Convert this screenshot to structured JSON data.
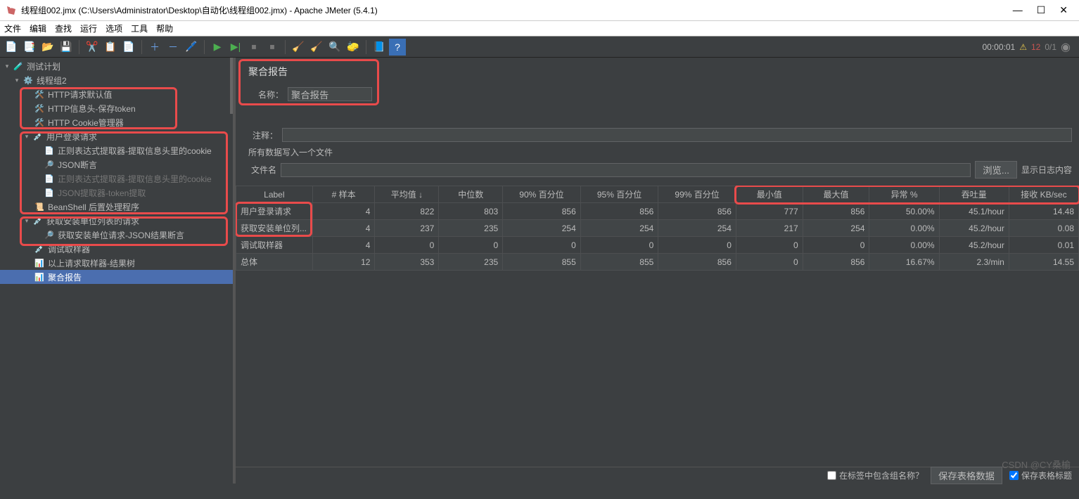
{
  "window": {
    "title": "线程组002.jmx (C:\\Users\\Administrator\\Desktop\\自动化\\线程组002.jmx) - Apache JMeter (5.4.1)"
  },
  "menu": {
    "file": "文件",
    "edit": "编辑",
    "find": "查找",
    "run": "运行",
    "options": "选项",
    "tools": "工具",
    "help": "帮助"
  },
  "status": {
    "timer": "00:00:01",
    "errors": "12",
    "threads": "0/1"
  },
  "tree": {
    "root": "测试计划",
    "threadGroup": "线程组2",
    "httpDefault": "HTTP请求默认值",
    "httpHeader": "HTTP信息头-保存token",
    "httpCookie": "HTTP Cookie管理器",
    "login": "用户登录请求",
    "regex1": "正则表达式提取器-提取信息头里的cookie",
    "jsonAssert": "JSON断言",
    "regex2": "正则表达式提取器-提取信息头里的cookie",
    "jsonExtract": "JSON提取器-token提取",
    "beanshell": "BeanShell 后置处理程序",
    "getList": "获取安装单位列表的请求",
    "getListAssert": "获取安装单位请求-JSON结果断言",
    "debugSampler": "调试取样器",
    "resultTree": "以上请求取样器-结果树",
    "aggregate": "聚合报告"
  },
  "form": {
    "sectionTitle": "聚合报告",
    "nameLabel": "名称：",
    "nameValue": "聚合报告",
    "commentLabel": "注释：",
    "writeAllLabel": "所有数据写入一个文件",
    "fileLabel": "文件名",
    "browse": "浏览...",
    "showLog": "显示日志内容"
  },
  "table": {
    "headers": {
      "label": "Label",
      "samples": "# 样本",
      "avg": "平均值 ↓",
      "median": "中位数",
      "p90": "90% 百分位",
      "p95": "95% 百分位",
      "p99": "99% 百分位",
      "min": "最小值",
      "max": "最大值",
      "error": "异常 %",
      "throughput": "吞吐量",
      "recv": "接收 KB/sec"
    },
    "rows": [
      {
        "label": "用户登录请求",
        "samples": "4",
        "avg": "822",
        "median": "803",
        "p90": "856",
        "p95": "856",
        "p99": "856",
        "min": "777",
        "max": "856",
        "error": "50.00%",
        "throughput": "45.1/hour",
        "recv": "14.48"
      },
      {
        "label": "获取安装单位列...",
        "samples": "4",
        "avg": "237",
        "median": "235",
        "p90": "254",
        "p95": "254",
        "p99": "254",
        "min": "217",
        "max": "254",
        "error": "0.00%",
        "throughput": "45.2/hour",
        "recv": "0.08"
      },
      {
        "label": "调试取样器",
        "samples": "4",
        "avg": "0",
        "median": "0",
        "p90": "0",
        "p95": "0",
        "p99": "0",
        "min": "0",
        "max": "0",
        "error": "0.00%",
        "throughput": "45.2/hour",
        "recv": "0.01"
      },
      {
        "label": "总体",
        "samples": "12",
        "avg": "353",
        "median": "235",
        "p90": "855",
        "p95": "855",
        "p99": "856",
        "min": "0",
        "max": "856",
        "error": "16.67%",
        "throughput": "2.3/min",
        "recv": "14.55"
      }
    ]
  },
  "bottom": {
    "includeGroup": "在标签中包含组名称？",
    "saveData": "保存表格数据",
    "saveHeader": "保存表格标题"
  },
  "watermark": "CSDN @CY桑榆"
}
